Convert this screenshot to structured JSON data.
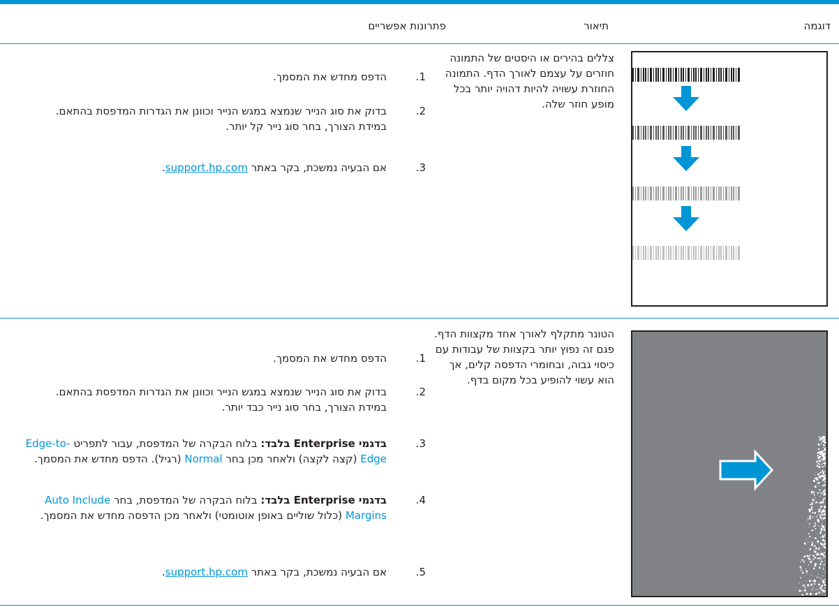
{
  "header": {
    "col_example": "דוגמה",
    "col_description": "תיאור",
    "col_solutions": "פתרונות אפשריים"
  },
  "row1": {
    "description": "צללים בהירים או היסטים של התמונה חוזרים על עצמם לאורך הדף. התמונה החוזרת עשויה להיות דהויה יותר בכל מופע חוזר שלה.",
    "solutions": [
      {
        "num": "1.",
        "text": "הדפס מחדש את המסמך."
      },
      {
        "num": "2.",
        "text": "בדוק את סוג הנייר שנמצא במגש הנייר וכוונן את הגדרות המדפסת בהתאם. במידת הצורך, בחר סוג נייר קל יותר."
      },
      {
        "num": "3.",
        "pre": "אם הבעיה נמשכת, בקר באתר ",
        "link": "support.hp.com",
        "post": "."
      }
    ]
  },
  "row2": {
    "description": "הטונר מתקלף לאורך אחד מקצוות הדף. פגם זה נפוץ יותר בקצוות של עבודות עם כיסוי גבוה, ובחומרי הדפסה קלים, אך הוא עשוי להופיע בכל מקום בדף.",
    "solutions": [
      {
        "num": "1.",
        "text": "הדפס מחדש את המסמך."
      },
      {
        "num": "2.",
        "text": "בדוק את סוג הנייר שנמצא במגש הנייר וכוונן את הגדרות המדפסת בהתאם. במידת הצורך, בחר סוג נייר כבד יותר."
      },
      {
        "num": "3.",
        "bold": "בדגמי Enterprise בלבד:",
        "t1": " בלוח הבקרה של המדפסת, עבור לתפריט ",
        "opt1": "Edge-to-Edge",
        "t2": " (קצה לקצה) ולאחר מכן בחר ",
        "opt2": "Normal",
        "t3": " (רגיל). הדפס מחדש את המסמך."
      },
      {
        "num": "4.",
        "bold": "בדגמי Enterprise בלבד:",
        "t1": " בלוח הבקרה של המדפסת, בחר ",
        "opt1": "Auto Include Margins",
        "t2": " (כלול שוליים באופן אוטומטי) ולאחר מכן הדפסה מחדש את המסמך."
      },
      {
        "num": "5.",
        "pre": "אם הבעיה נמשכת, בקר באתר ",
        "link": "support.hp.com",
        "post": "."
      }
    ]
  },
  "colors": {
    "accent": "#0096d6",
    "gray_page": "#818285",
    "text": "#231f20"
  }
}
